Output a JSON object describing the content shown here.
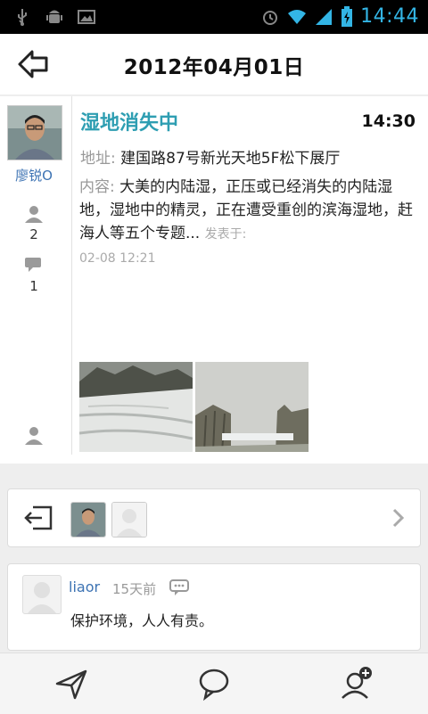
{
  "status_bar": {
    "time": "14:44"
  },
  "header": {
    "title": "2012年04月01日"
  },
  "post": {
    "author": "廖锐O",
    "participants_count": "2",
    "comments_count": "1",
    "title": "湿地消失中",
    "time": "14:30",
    "address_label": "地址:",
    "address": "建国路87号新光天地5F松下展厅",
    "content_label": "内容:",
    "content": "大美的内陆湿，正压或已经消失的内陆湿地，湿地中的精灵，正在遭受重创的滨海湿地，赶海人等五个专题...",
    "published_label": "发表于:",
    "published_time": "02-08 12:21"
  },
  "comment": {
    "user": "liaor",
    "time": "15天前",
    "text": "保护环境，人人有责。"
  },
  "colors": {
    "accent": "#2e9eb2",
    "link": "#3d73b3",
    "status": "#33b5e5"
  }
}
